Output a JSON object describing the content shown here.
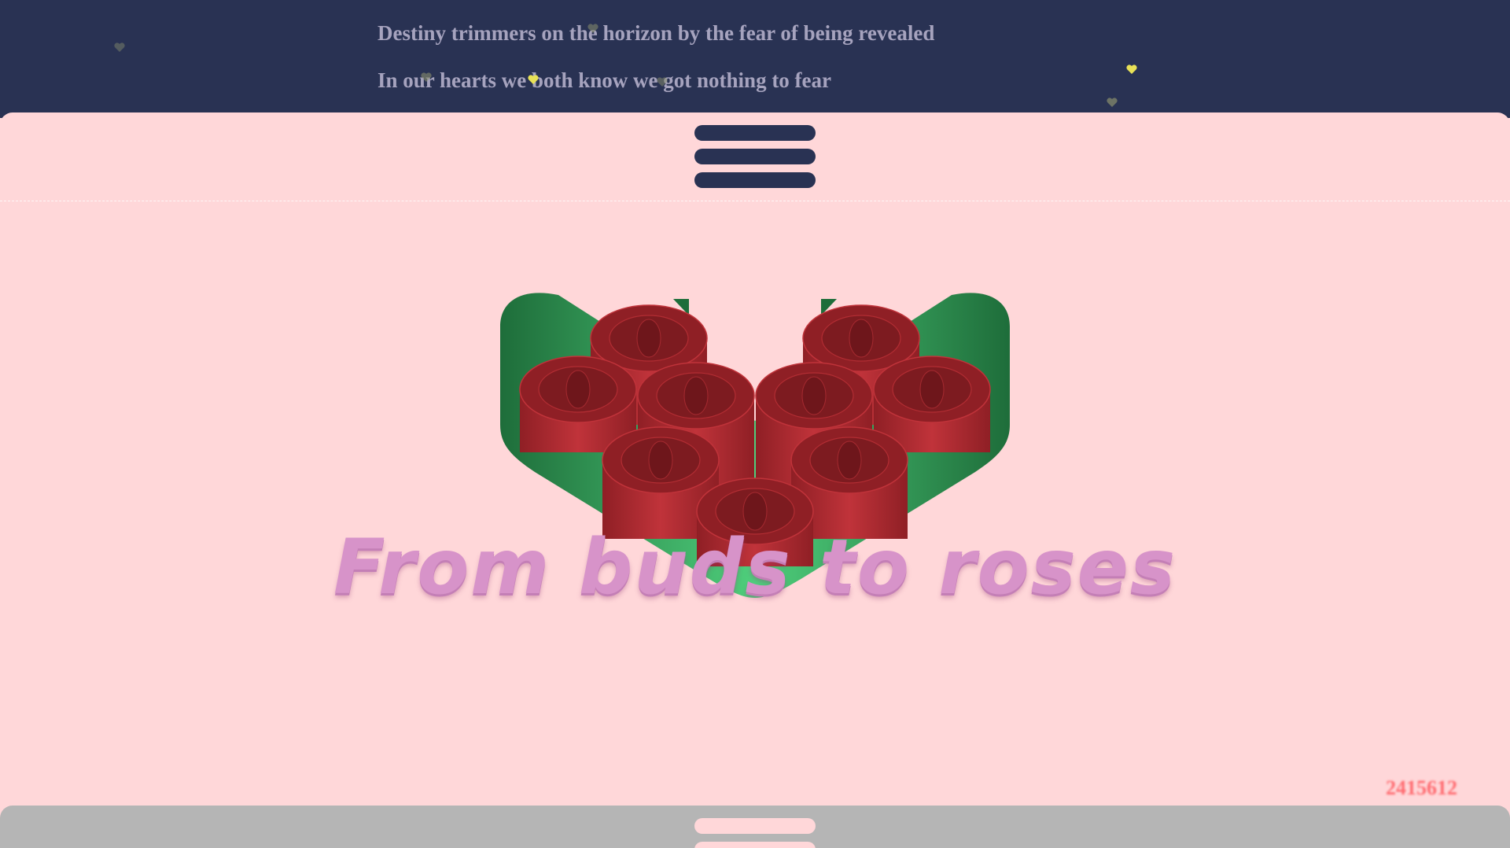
{
  "lyrics": {
    "line1": "Destiny trimmers on the horizon by the fear of being revealed",
    "line2": "In our hearts we both know we got nothing to fear"
  },
  "menu": {
    "icon": "hamburger-menu-icon"
  },
  "headline": "From buds to roses",
  "counter": "2415612",
  "bottom_panel": {
    "icon": "drawer-handle-icon"
  },
  "colors": {
    "header_bg": "#293253",
    "page_bg": "#ffd7d9",
    "lyric_text": "#a6a3be",
    "headline_text": "#d793c9",
    "counter_text": "#ff6b70",
    "rose_red": "#a3262c",
    "leaf_green": "#2c9a4f",
    "heart_yellow": "#e8e157",
    "bottom_panel_bg": "#b5b5b5"
  }
}
